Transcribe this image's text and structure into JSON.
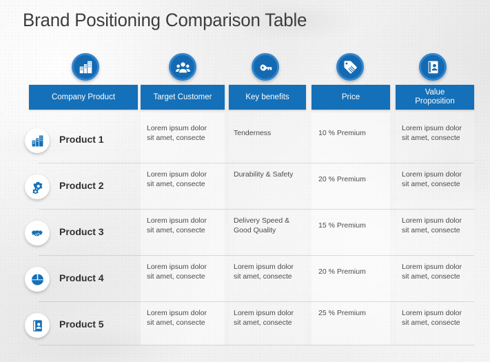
{
  "slide": {
    "title": "Brand Positioning Comparison Table",
    "accent_color": "#1470b8",
    "accent_ring_color": "#2f86d0",
    "title_color": "#3d3d3d",
    "background_color": "#eeeeee"
  },
  "table": {
    "columns": [
      {
        "label": "Company Product",
        "icon": "building-icon"
      },
      {
        "label": "Target Customer",
        "icon": "people-group-icon"
      },
      {
        "label": "Key benefits",
        "icon": "key-icon"
      },
      {
        "label": "Price",
        "icon": "price-tag-icon"
      },
      {
        "label": "Value\nProposition",
        "label_line1": "Value",
        "label_line2": "Proposition",
        "icon": "contact-card-icon"
      }
    ],
    "rows": [
      {
        "icon": "building-icon",
        "product": "Product 1",
        "target_customer": "Lorem ipsum dolor sit amet, consecte",
        "key_benefits": "Tenderness",
        "price": "10 % Premium",
        "value_proposition": "Lorem ipsum dolor sit amet, consecte"
      },
      {
        "icon": "gears-icon",
        "product": "Product 2",
        "target_customer": "Lorem ipsum dolor sit amet, consecte",
        "key_benefits": "Durability  &  Safety",
        "price": "20 % Premium",
        "value_proposition": "Lorem ipsum dolor sit amet, consecte"
      },
      {
        "icon": "handshake-icon",
        "product": "Product 3",
        "target_customer": "Lorem ipsum dolor sit amet, consecte",
        "key_benefits": "Delivery Speed & Good Quality",
        "price": "15 % Premium",
        "value_proposition": "Lorem ipsum dolor sit amet, consecte"
      },
      {
        "icon": "pie-chart-icon",
        "product": "Product 4",
        "target_customer": "Lorem ipsum dolor sit amet, consecte",
        "key_benefits": "Lorem ipsum dolor sit amet, consecte",
        "price": "20 % Premium",
        "value_proposition": "Lorem ipsum dolor sit amet, consecte"
      },
      {
        "icon": "contact-card-icon",
        "product": "Product 5",
        "target_customer": "Lorem ipsum dolor sit amet, consecte",
        "key_benefits": "Lorem ipsum dolor sit amet, consecte",
        "price": "25 % Premium",
        "value_proposition": "Lorem ipsum dolor sit amet, consecte"
      }
    ]
  }
}
